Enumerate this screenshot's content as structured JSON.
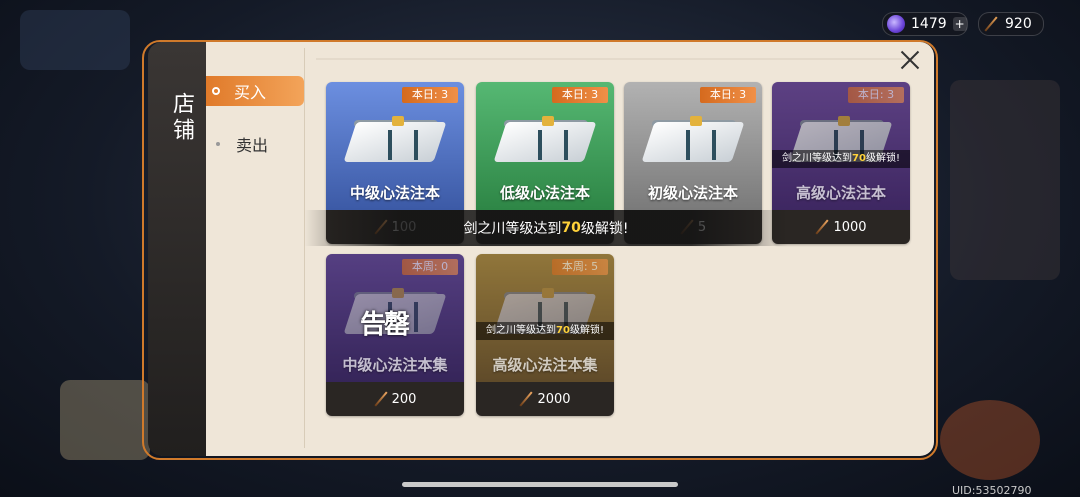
{
  "currency": [
    {
      "icon": "gem-icon",
      "amount": "1479",
      "plus": "+"
    },
    {
      "icon": "brush-icon",
      "amount": "920"
    }
  ],
  "shop": {
    "title": "店铺",
    "tabs": [
      "买入",
      "卖出"
    ],
    "active_tab": "买入",
    "banner": {
      "prefix": "剑之川等级达到",
      "level": "70",
      "suffix": "级解锁!"
    },
    "items": [
      {
        "name": "中级心法注本",
        "limit": "本日: 3",
        "price": "100",
        "color": "#4c6fbf"
      },
      {
        "name": "低级心法注本",
        "limit": "本日: 3",
        "price": "",
        "color": "#3e9a56"
      },
      {
        "name": "初级心法注本",
        "limit": "本日: 3",
        "price": "5",
        "color": "#8e8e8e"
      },
      {
        "name": "高级心法注本",
        "limit": "本日: 3",
        "price": "1000",
        "color": "#5f3c8e",
        "lock": {
          "prefix": "剑之川等级达到",
          "level": "70",
          "suffix": "级解锁!"
        }
      },
      {
        "name": "中级心法注本集",
        "limit": "本周: 0",
        "price": "200",
        "color": "#5a3e8c",
        "seal": "告罄"
      },
      {
        "name": "高级心法注本集",
        "limit": "本周: 5",
        "price": "2000",
        "color": "#a98a2c",
        "lock": {
          "prefix": "剑之川等级达到",
          "level": "70",
          "suffix": "级解锁!"
        }
      }
    ]
  },
  "uid": "UID:53502790"
}
